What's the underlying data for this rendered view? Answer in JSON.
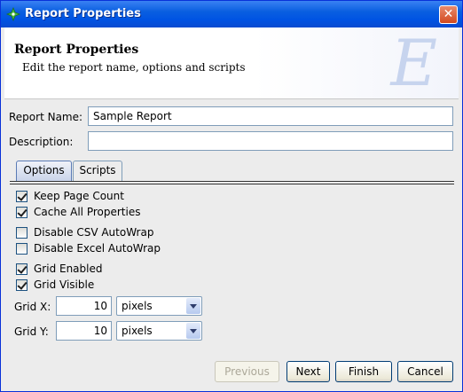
{
  "window": {
    "title": "Report Properties"
  },
  "header": {
    "title": "Report Properties",
    "subtitle": "Edit the report name, options and scripts",
    "logo_letter": "E"
  },
  "form": {
    "name_label": "Report Name:",
    "name_value": "Sample Report",
    "description_label": "Description:",
    "description_value": ""
  },
  "tabs": [
    {
      "label": "Options",
      "active": true
    },
    {
      "label": "Scripts",
      "active": false
    }
  ],
  "options": [
    {
      "label": "Keep Page Count",
      "checked": true
    },
    {
      "label": "Cache All Properties",
      "checked": true
    },
    {
      "label": "Disable CSV AutoWrap",
      "checked": false
    },
    {
      "label": "Disable Excel AutoWrap",
      "checked": false
    },
    {
      "label": "Grid Enabled",
      "checked": true
    },
    {
      "label": "Grid Visible",
      "checked": true
    }
  ],
  "grid": {
    "x_label": "Grid X:",
    "x_value": "10",
    "x_unit": "pixels",
    "y_label": "Grid Y:",
    "y_value": "10",
    "y_unit": "pixels"
  },
  "buttons": {
    "previous": "Previous",
    "next": "Next",
    "finish": "Finish",
    "cancel": "Cancel"
  },
  "icons": {
    "app": "compass-icon",
    "close": "close-icon"
  },
  "colors": {
    "titlebar": "#0054e3",
    "accent": "#7f9db9"
  }
}
